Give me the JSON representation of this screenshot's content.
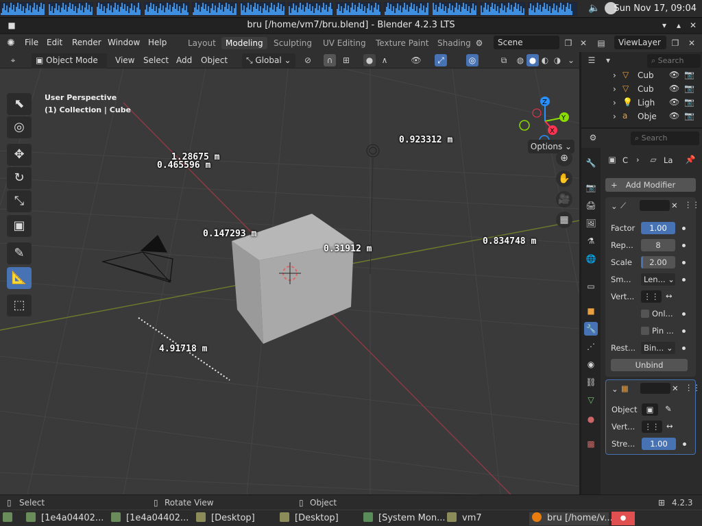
{
  "system": {
    "clock": "Sun Nov 17, 09:04",
    "volume_icon": "speaker-icon",
    "network_icon": "network-icon"
  },
  "window": {
    "title": "bru [/home/vm7/bru.blend] - Blender 4.2.3 LTS"
  },
  "topmenu": {
    "items": [
      "File",
      "Edit",
      "Render",
      "Window",
      "Help"
    ],
    "workspaces": [
      "Layout",
      "Modeling",
      "Sculpting",
      "UV Editing",
      "Texture Paint",
      "Shading"
    ],
    "active_workspace": "Modeling",
    "scene": "Scene",
    "view_layer": "ViewLayer"
  },
  "viewport_header": {
    "mode": "Object Mode",
    "menus": [
      "View",
      "Select",
      "Add",
      "Object"
    ],
    "orientation": "Global",
    "options": "Options"
  },
  "viewport": {
    "perspective": "User Perspective",
    "collection": "(1) Collection | Cube",
    "measurements": [
      "1.28675  m",
      "0.465596  m",
      "0.923312  m",
      "0.147293  m",
      "0.31912  m",
      "0.834748  m",
      "4.91718  m"
    ],
    "gizmo_axes": {
      "x": "X",
      "y": "Y",
      "z": "Z"
    }
  },
  "outliner": {
    "search_placeholder": "Search",
    "rows": [
      {
        "label": "Cub",
        "icon": "mesh-icon"
      },
      {
        "label": "Cub",
        "icon": "mesh-icon"
      },
      {
        "label": "Ligh",
        "icon": "light-icon"
      },
      {
        "label": "Obje",
        "icon": "object-icon"
      }
    ]
  },
  "properties": {
    "search_placeholder": "Search",
    "breadcrumb": [
      "C",
      "La"
    ],
    "add_modifier": "Add Modifier",
    "mod1": {
      "factor_label": "Factor",
      "factor_value": "1.00",
      "repeat_label": "Rep...",
      "repeat_value": "8",
      "scale_label": "Scale",
      "scale_value": "2.00",
      "smooth_label": "Sm...",
      "smooth_value": "Len...",
      "vertex_label": "Vert...",
      "only_label": "Onl...",
      "pin_label": "Pin ...",
      "rest_label": "Rest...",
      "rest_value": "Bin...",
      "unbind": "Unbind"
    },
    "mod2": {
      "object_label": "Object",
      "vertex_label": "Vert...",
      "strength_label": "Stre...",
      "strength_value": "1.00"
    }
  },
  "statusbar": {
    "select": "Select",
    "rotate": "Rotate View",
    "object": "Object",
    "version": "4.2.3"
  },
  "taskbar": {
    "items": [
      "[1e4a04402...",
      "[1e4a04402...",
      "[Desktop]",
      "[Desktop]",
      "[System Mon...",
      "vm7",
      "bru [/home/v..."
    ]
  },
  "colors": {
    "accent": "#4772b3",
    "x_axis": "#ff3352",
    "y_axis": "#8bdc00",
    "z_axis": "#2890ff"
  }
}
